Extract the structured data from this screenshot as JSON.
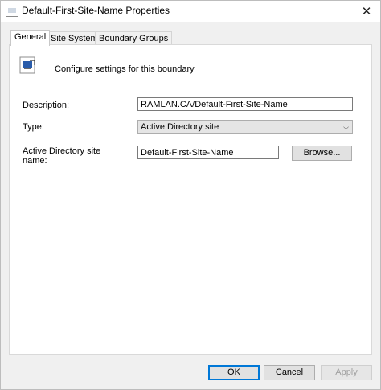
{
  "window": {
    "title": "Default-First-Site-Name Properties",
    "close_glyph": "✕"
  },
  "tabs": [
    {
      "label": "General",
      "active": true
    },
    {
      "label": "Site Systems",
      "active": false
    },
    {
      "label": "Boundary Groups",
      "active": false
    }
  ],
  "general": {
    "intro_text": "Configure settings for this boundary",
    "description_label": "Description:",
    "description_value": "RAMLAN.CA/Default-First-Site-Name",
    "type_label": "Type:",
    "type_value": "Active Directory site",
    "ad_site_label_line1": "Active Directory site",
    "ad_site_label_line2": "name:",
    "ad_site_value": "Default-First-Site-Name",
    "browse_label": "Browse..."
  },
  "footer": {
    "ok_label": "OK",
    "cancel_label": "Cancel",
    "apply_label": "Apply"
  },
  "colors": {
    "accent": "#0078d7"
  }
}
